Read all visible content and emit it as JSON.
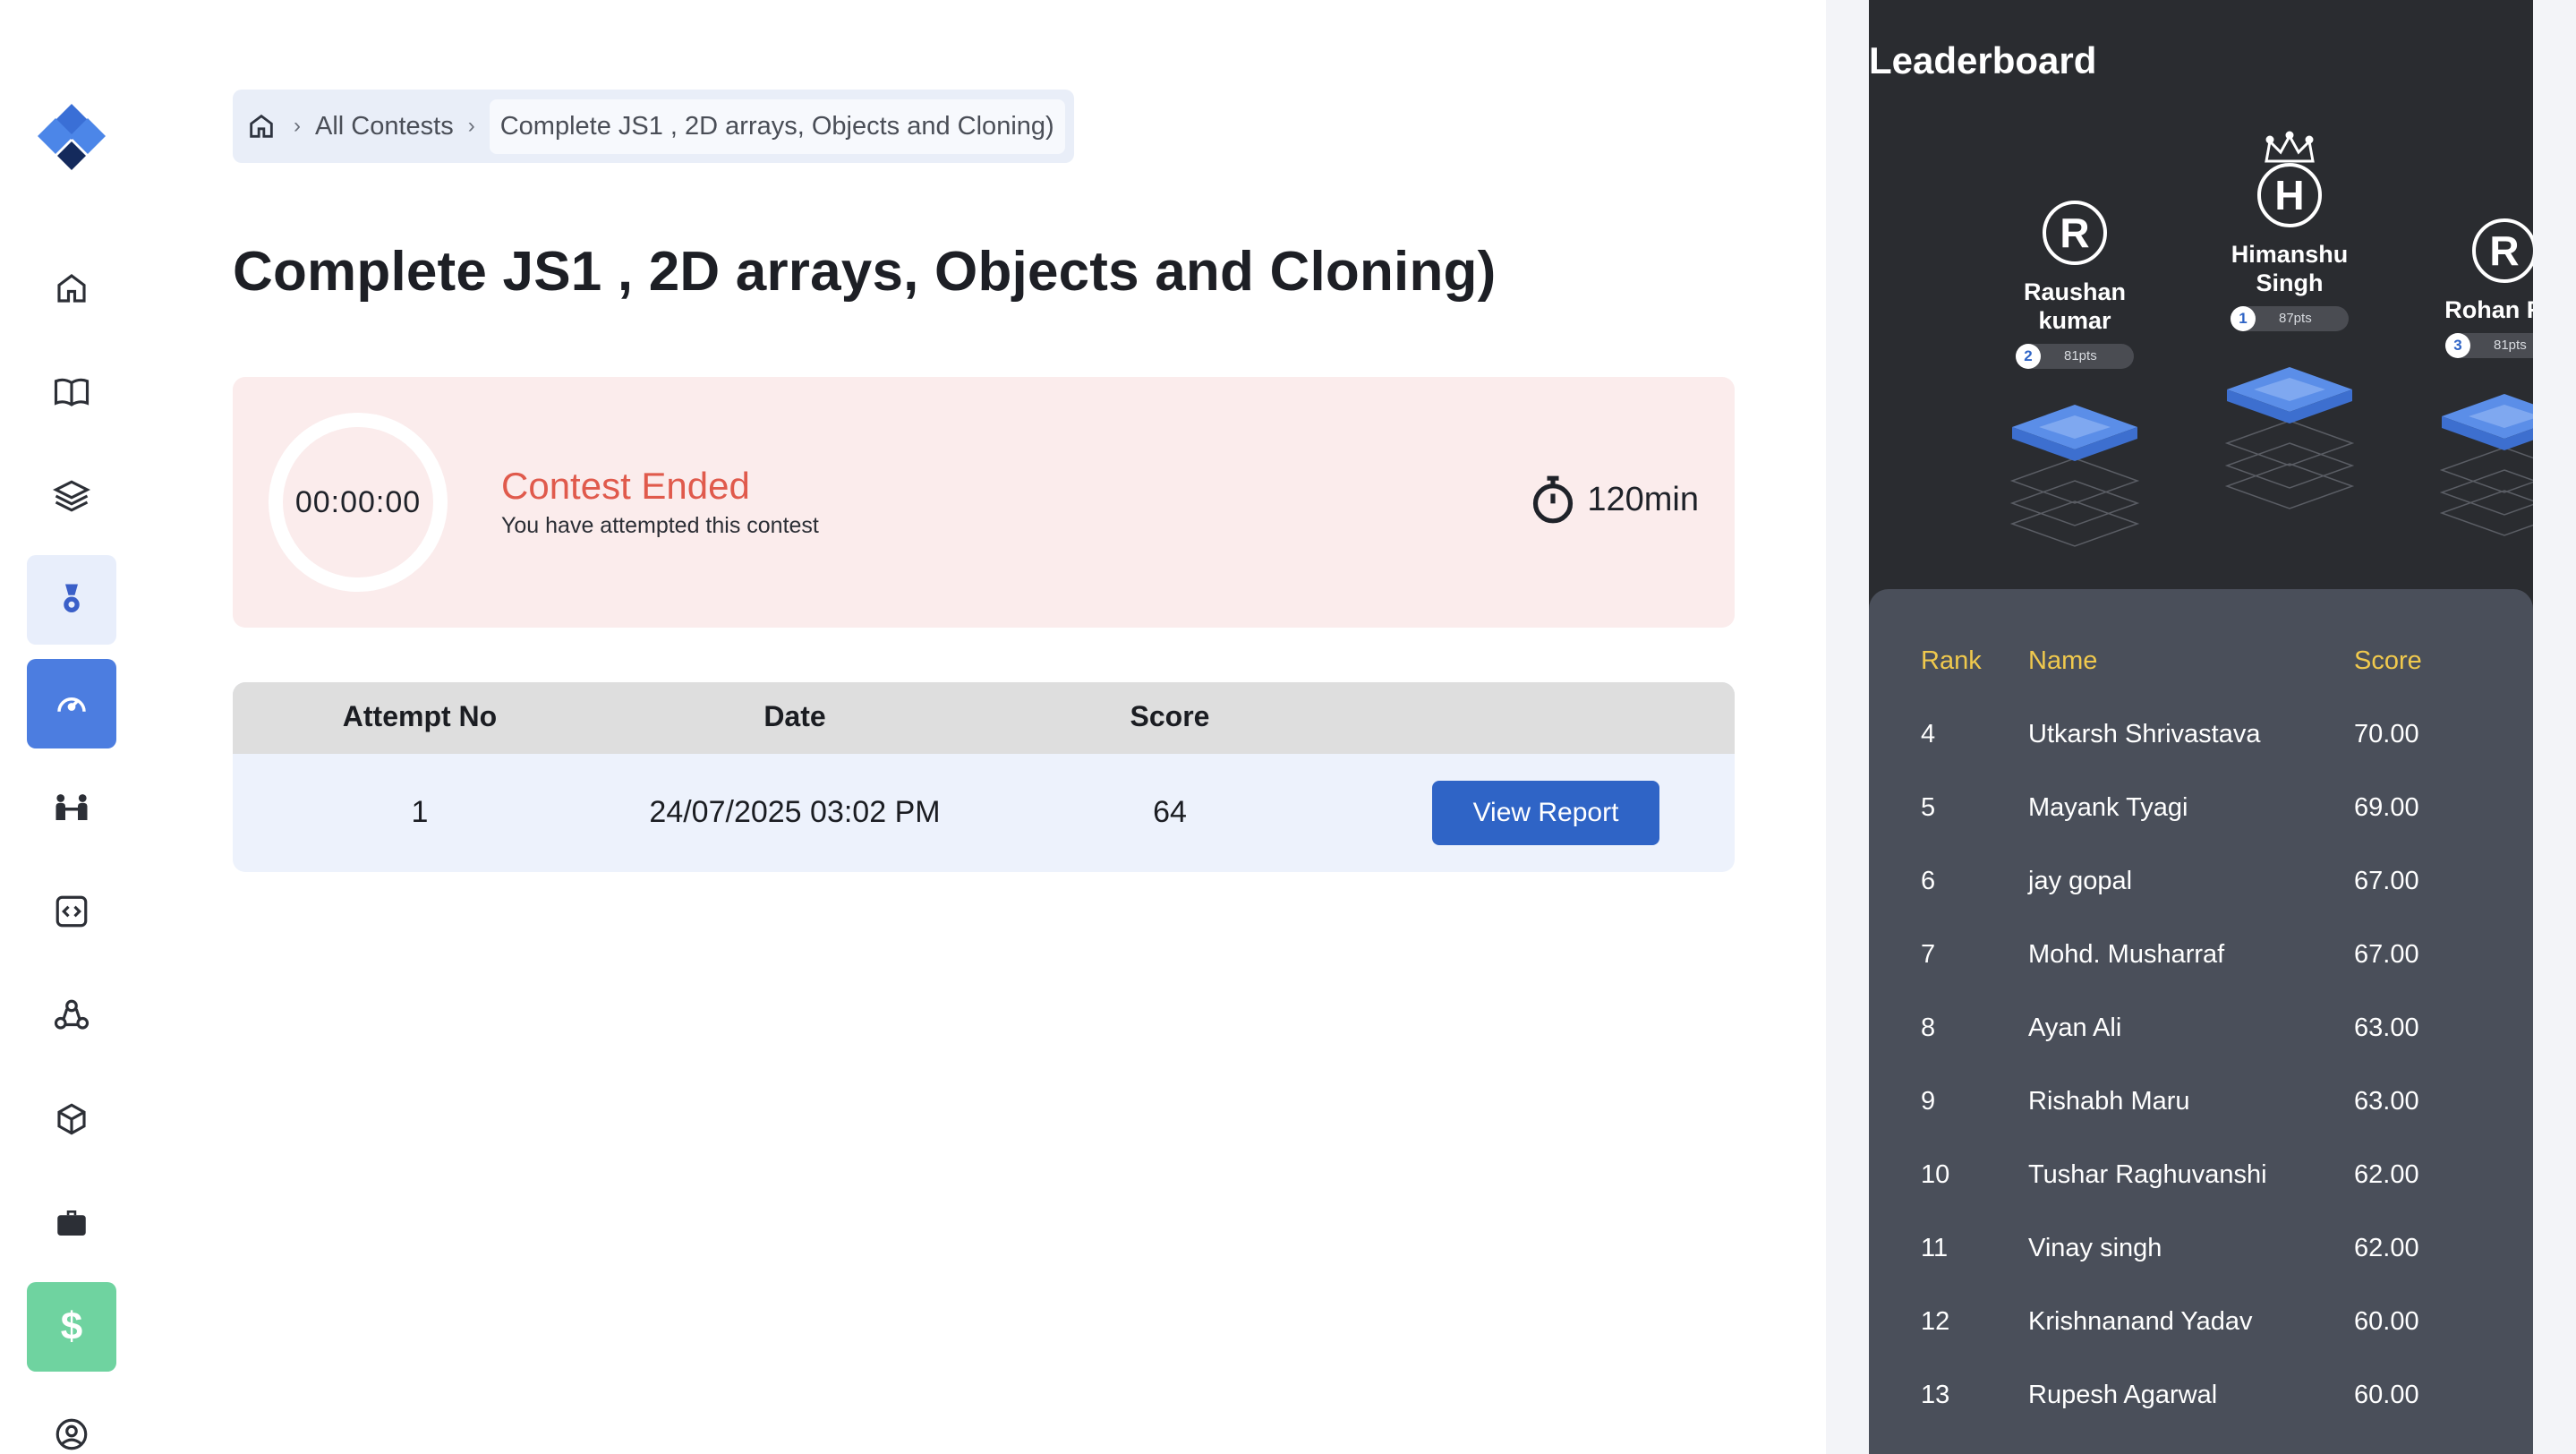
{
  "breadcrumb": {
    "home_label": "",
    "items": [
      "All Contests",
      "Complete JS1 , 2D arrays, Objects and Cloning)"
    ]
  },
  "contest": {
    "title": "Complete JS1 , 2D arrays, Objects and Cloning)",
    "timer": "00:00:00",
    "status": "Contest Ended",
    "status_sub": "You have attempted this contest",
    "duration": "120min"
  },
  "attempts": {
    "headers": [
      "Attempt No",
      "Date",
      "Score"
    ],
    "rows": [
      {
        "attempt": "1",
        "date": "24/07/2025 03:02 PM",
        "score": "64",
        "action": "View Report"
      }
    ]
  },
  "leaderboard": {
    "title": "Leaderboard",
    "podium": [
      {
        "initial": "R",
        "name": "Raushan kumar",
        "rank": "2",
        "points": "81pts"
      },
      {
        "initial": "H",
        "name": "Himanshu Singh",
        "rank": "1",
        "points": "87pts"
      },
      {
        "initial": "R",
        "name": "Rohan Rai",
        "rank": "3",
        "points": "81pts"
      }
    ],
    "headers": {
      "rank": "Rank",
      "name": "Name",
      "score": "Score"
    },
    "rows": [
      {
        "rank": "4",
        "name": "Utkarsh Shrivastava",
        "score": "70.00"
      },
      {
        "rank": "5",
        "name": "Mayank Tyagi",
        "score": "69.00"
      },
      {
        "rank": "6",
        "name": "jay gopal",
        "score": "67.00"
      },
      {
        "rank": "7",
        "name": "Mohd. Musharraf",
        "score": "67.00"
      },
      {
        "rank": "8",
        "name": "Ayan Ali",
        "score": "63.00"
      },
      {
        "rank": "9",
        "name": "Rishabh Maru",
        "score": "63.00"
      },
      {
        "rank": "10",
        "name": "Tushar Raghuvanshi",
        "score": "62.00"
      },
      {
        "rank": "11",
        "name": "Vinay singh",
        "score": "62.00"
      },
      {
        "rank": "12",
        "name": "Krishnanand Yadav",
        "score": "60.00"
      },
      {
        "rank": "13",
        "name": "Rupesh Agarwal",
        "score": "60.00"
      }
    ]
  },
  "sidebar": {
    "items": [
      {
        "icon": "home-icon"
      },
      {
        "icon": "book-icon"
      },
      {
        "icon": "layers-icon"
      },
      {
        "icon": "medal-icon"
      },
      {
        "icon": "contest-icon"
      },
      {
        "icon": "mentorship-icon"
      },
      {
        "icon": "code-icon"
      },
      {
        "icon": "community-icon"
      },
      {
        "icon": "cube-icon"
      },
      {
        "icon": "briefcase-icon"
      },
      {
        "icon": "dollar-icon",
        "label": "$"
      },
      {
        "icon": "profile-icon"
      }
    ]
  },
  "colors": {
    "accent": "#4c7de0",
    "danger": "#e05a4c",
    "leaderboard_bg": "#2a2c30",
    "table_header_gold": "#f0c94d",
    "success": "#6fd3a0"
  }
}
